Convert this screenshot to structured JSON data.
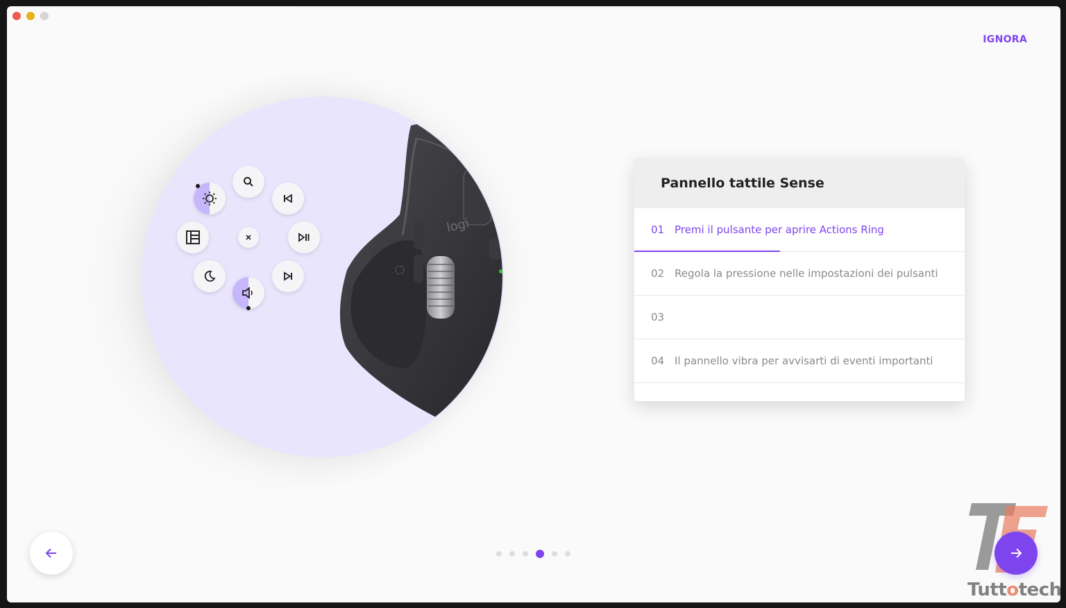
{
  "window": {
    "controls": [
      "close",
      "minimize",
      "zoom"
    ]
  },
  "header": {
    "skip_label": "IGNORA"
  },
  "illustration": {
    "mouse_logo_text": "logi",
    "actions_ring": [
      {
        "icon": "search-icon"
      },
      {
        "icon": "previous-track-icon"
      },
      {
        "icon": "play-pause-icon"
      },
      {
        "icon": "next-track-icon"
      },
      {
        "icon": "volume-icon"
      },
      {
        "icon": "moon-icon"
      },
      {
        "icon": "layout-icon"
      },
      {
        "icon": "brightness-icon"
      },
      {
        "icon": "close-icon"
      }
    ]
  },
  "card": {
    "title": "Pannello tattile Sense",
    "steps": [
      {
        "num": "01",
        "text": "Premi il pulsante per aprire Actions Ring",
        "active": true
      },
      {
        "num": "02",
        "text": "Regola la pressione nelle impostazioni dei pulsanti",
        "active": false
      },
      {
        "num": "03",
        "text": "",
        "active": false
      },
      {
        "num": "04",
        "text": "Il pannello vibra per avvisarti di eventi importanti",
        "active": false
      }
    ]
  },
  "pagination": {
    "total": 6,
    "current": 4
  },
  "navigation": {
    "back_icon": "arrow-left-icon",
    "next_icon": "arrow-right-icon"
  },
  "watermark": {
    "text_main": "Tutt",
    "text_accent": "o",
    "text_end": "tech"
  },
  "colors": {
    "accent": "#7e44ee",
    "circle_bg": "#e9e5fd",
    "ring_highlight": "#c6b6fb"
  }
}
